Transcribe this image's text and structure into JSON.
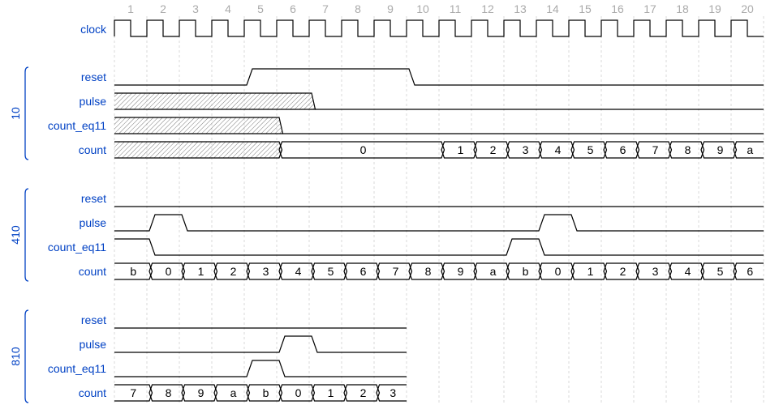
{
  "diagram": {
    "type": "timing-waveform",
    "cycles": 20,
    "tick_labels": [
      "1",
      "2",
      "3",
      "4",
      "5",
      "6",
      "7",
      "8",
      "9",
      "10",
      "11",
      "12",
      "13",
      "14",
      "15",
      "16",
      "17",
      "18",
      "19",
      "20"
    ],
    "clock": {
      "name": "clock",
      "pattern": "p",
      "cycles": 20
    },
    "groups": [
      {
        "label": "10",
        "cycles": 20,
        "signals": [
          {
            "name": "reset",
            "wave": "0000111110000000000000",
            "levels": [
              "0",
              "0",
              "0",
              "0",
              "1",
              "1",
              "1",
              "1",
              "1",
              "0",
              "0",
              "0",
              "0",
              "0",
              "0",
              "0",
              "0",
              "0",
              "0",
              "0"
            ]
          },
          {
            "name": "pulse",
            "levels": [
              "x",
              "x",
              "x",
              "x",
              "x",
              "x",
              "0",
              "0",
              "0",
              "0",
              "0",
              "0",
              "0",
              "0",
              "0",
              "0",
              "0",
              "0",
              "0",
              "0"
            ]
          },
          {
            "name": "count_eq11",
            "levels": [
              "x",
              "x",
              "x",
              "x",
              "x",
              "0",
              "0",
              "0",
              "0",
              "0",
              "0",
              "0",
              "0",
              "0",
              "0",
              "0",
              "0",
              "0",
              "0",
              "0"
            ]
          },
          {
            "name": "count",
            "bus": [
              "x",
              "x",
              "x",
              "x",
              "x",
              "0",
              ".",
              ".",
              ".",
              ".",
              "1",
              "2",
              "3",
              "4",
              "5",
              "6",
              "7",
              "8",
              "9",
              "a"
            ]
          }
        ]
      },
      {
        "label": "410",
        "cycles": 20,
        "signals": [
          {
            "name": "reset",
            "levels": [
              "0",
              "0",
              "0",
              "0",
              "0",
              "0",
              "0",
              "0",
              "0",
              "0",
              "0",
              "0",
              "0",
              "0",
              "0",
              "0",
              "0",
              "0",
              "0",
              "0"
            ]
          },
          {
            "name": "pulse",
            "levels": [
              "0",
              "1",
              "0",
              "0",
              "0",
              "0",
              "0",
              "0",
              "0",
              "0",
              "0",
              "0",
              "0",
              "1",
              "0",
              "0",
              "0",
              "0",
              "0",
              "0"
            ]
          },
          {
            "name": "count_eq11",
            "levels": [
              "1",
              "0",
              "0",
              "0",
              "0",
              "0",
              "0",
              "0",
              "0",
              "0",
              "0",
              "0",
              "1",
              "0",
              "0",
              "0",
              "0",
              "0",
              "0",
              "0"
            ]
          },
          {
            "name": "count",
            "bus": [
              "b",
              "0",
              "1",
              "2",
              "3",
              "4",
              "5",
              "6",
              "7",
              "8",
              "9",
              "a",
              "b",
              "0",
              "1",
              "2",
              "3",
              "4",
              "5",
              "6"
            ]
          }
        ]
      },
      {
        "label": "810",
        "cycles": 9,
        "signals": [
          {
            "name": "reset",
            "levels": [
              "0",
              "0",
              "0",
              "0",
              "0",
              "0",
              "0",
              "0",
              "0"
            ]
          },
          {
            "name": "pulse",
            "levels": [
              "0",
              "0",
              "0",
              "0",
              "0",
              "1",
              "0",
              "0",
              "0"
            ]
          },
          {
            "name": "count_eq11",
            "levels": [
              "0",
              "0",
              "0",
              "0",
              "1",
              "0",
              "0",
              "0",
              "0"
            ]
          },
          {
            "name": "count",
            "bus": [
              "7",
              "8",
              "9",
              "a",
              "b",
              "0",
              "1",
              "2",
              "3"
            ]
          }
        ]
      }
    ]
  },
  "colors": {
    "label": "#0041c4",
    "tick": "#aaaaaa",
    "grid": "#d8d8d8",
    "wave": "#000000",
    "hatch": "#888888"
  }
}
